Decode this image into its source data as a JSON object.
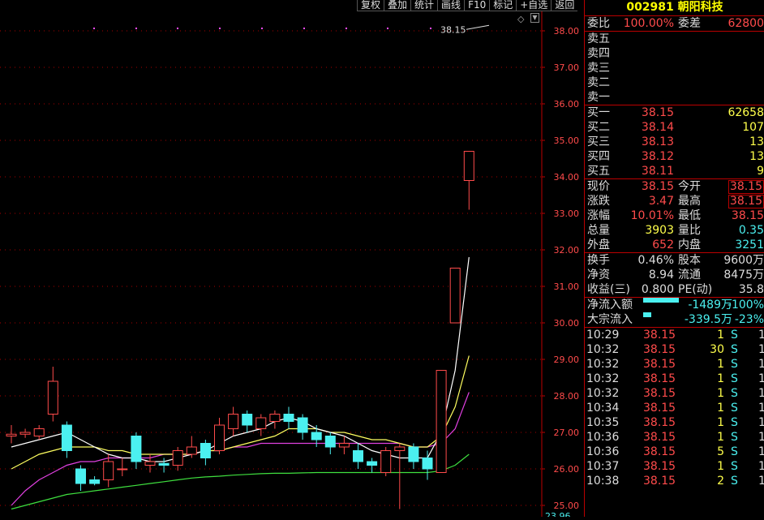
{
  "toolbar": [
    "复权",
    "叠加",
    "统计",
    "画线",
    "F10",
    "标记",
    "+自选",
    "返回"
  ],
  "chart_data": {
    "type": "candlestick",
    "y_ticks": [
      "38.00",
      "37.00",
      "36.00",
      "35.00",
      "34.00",
      "33.00",
      "32.00",
      "31.00",
      "30.00",
      "29.00",
      "28.00",
      "27.00",
      "26.00",
      "25.00"
    ],
    "ylim": [
      24.8,
      38.4
    ],
    "bottom_label": "23.96",
    "price_flag": "38.15",
    "candles": [
      {
        "o": 26.9,
        "c": 26.95,
        "h": 27.2,
        "l": 26.7
      },
      {
        "o": 26.95,
        "c": 27.0,
        "h": 27.1,
        "l": 26.85
      },
      {
        "o": 26.9,
        "c": 27.1,
        "h": 27.2,
        "l": 26.8
      },
      {
        "o": 27.5,
        "c": 28.4,
        "h": 28.8,
        "l": 27.3
      },
      {
        "o": 27.2,
        "c": 26.5,
        "h": 27.3,
        "l": 26.3
      },
      {
        "o": 26.0,
        "c": 25.6,
        "h": 26.1,
        "l": 25.4
      },
      {
        "o": 25.7,
        "c": 25.6,
        "h": 25.8,
        "l": 25.55
      },
      {
        "o": 25.7,
        "c": 26.2,
        "h": 26.4,
        "l": 25.5
      },
      {
        "o": 26.0,
        "c": 26.0,
        "h": 26.3,
        "l": 25.8
      },
      {
        "o": 26.9,
        "c": 26.2,
        "h": 27.0,
        "l": 26.0
      },
      {
        "o": 26.1,
        "c": 26.2,
        "h": 26.4,
        "l": 25.9
      },
      {
        "o": 26.15,
        "c": 26.1,
        "h": 26.3,
        "l": 25.9
      },
      {
        "o": 26.1,
        "c": 26.5,
        "h": 26.6,
        "l": 25.95
      },
      {
        "o": 26.4,
        "c": 26.6,
        "h": 26.9,
        "l": 26.3
      },
      {
        "o": 26.7,
        "c": 26.3,
        "h": 26.8,
        "l": 26.1
      },
      {
        "o": 26.5,
        "c": 27.2,
        "h": 27.4,
        "l": 26.4
      },
      {
        "o": 27.1,
        "c": 27.5,
        "h": 27.7,
        "l": 26.9
      },
      {
        "o": 27.5,
        "c": 27.2,
        "h": 27.6,
        "l": 27.0
      },
      {
        "o": 27.1,
        "c": 27.4,
        "h": 27.5,
        "l": 26.9
      },
      {
        "o": 27.3,
        "c": 27.5,
        "h": 27.6,
        "l": 27.1
      },
      {
        "o": 27.5,
        "c": 27.3,
        "h": 27.7,
        "l": 27.1
      },
      {
        "o": 27.4,
        "c": 27.0,
        "h": 27.5,
        "l": 26.8
      },
      {
        "o": 27.0,
        "c": 26.8,
        "h": 27.2,
        "l": 26.6
      },
      {
        "o": 26.9,
        "c": 26.6,
        "h": 27.0,
        "l": 26.4
      },
      {
        "o": 26.6,
        "c": 26.7,
        "h": 26.9,
        "l": 26.4
      },
      {
        "o": 26.5,
        "c": 26.2,
        "h": 26.7,
        "l": 26.0
      },
      {
        "o": 26.2,
        "c": 26.1,
        "h": 26.3,
        "l": 25.9
      },
      {
        "o": 25.9,
        "c": 26.5,
        "h": 26.6,
        "l": 25.8
      },
      {
        "o": 26.5,
        "c": 26.6,
        "h": 26.7,
        "l": 24.9
      },
      {
        "o": 26.6,
        "c": 26.2,
        "h": 26.7,
        "l": 26.0
      },
      {
        "o": 26.3,
        "c": 26.0,
        "h": 26.5,
        "l": 25.7
      },
      {
        "o": 25.9,
        "c": 28.7,
        "h": 28.7,
        "l": 25.9
      },
      {
        "o": 30.0,
        "c": 31.5,
        "h": 31.5,
        "l": 30.0
      },
      {
        "o": 33.9,
        "c": 34.7,
        "h": 34.7,
        "l": 33.1
      }
    ],
    "ma_white": [
      26.6,
      26.7,
      26.8,
      26.9,
      27.0,
      26.8,
      26.6,
      26.4,
      26.3,
      26.3,
      26.2,
      26.2,
      26.3,
      26.4,
      26.5,
      26.7,
      26.9,
      27.0,
      27.1,
      27.3,
      27.4,
      27.3,
      27.1,
      27.0,
      26.9,
      26.7,
      26.5,
      26.4,
      26.3,
      26.3,
      26.3,
      27.0,
      28.7,
      31.8
    ],
    "ma_yellow": [
      26.0,
      26.2,
      26.4,
      26.5,
      26.6,
      26.6,
      26.6,
      26.5,
      26.5,
      26.4,
      26.4,
      26.4,
      26.4,
      26.4,
      26.5,
      26.5,
      26.6,
      26.7,
      26.8,
      26.9,
      27.1,
      27.1,
      27.1,
      27.0,
      27.0,
      26.9,
      26.8,
      26.8,
      26.7,
      26.6,
      26.6,
      26.9,
      27.7,
      29.1
    ],
    "ma_magenta": [
      25.0,
      25.4,
      25.7,
      25.9,
      26.1,
      26.2,
      26.2,
      26.3,
      26.3,
      26.3,
      26.3,
      26.4,
      26.4,
      26.4,
      26.5,
      26.5,
      26.6,
      26.6,
      26.7,
      26.7,
      26.7,
      26.7,
      26.7,
      26.7,
      26.7,
      26.7,
      26.7,
      26.7,
      26.7,
      26.6,
      26.6,
      26.7,
      27.1,
      28.1
    ],
    "ma_green": [
      24.9,
      25.0,
      25.1,
      25.2,
      25.3,
      25.35,
      25.4,
      25.45,
      25.5,
      25.55,
      25.6,
      25.65,
      25.7,
      25.75,
      25.78,
      25.8,
      25.83,
      25.85,
      25.87,
      25.88,
      25.88,
      25.89,
      25.9,
      25.9,
      25.9,
      25.9,
      25.9,
      25.9,
      25.9,
      25.9,
      25.9,
      25.95,
      26.1,
      26.4
    ]
  },
  "panel": {
    "title": "002981 朝阳科技",
    "wb": {
      "label1": "委比",
      "value1": "100.00%",
      "label2": "委差",
      "value2": "62800"
    },
    "asks": [
      {
        "label": "卖五"
      },
      {
        "label": "卖四"
      },
      {
        "label": "卖三"
      },
      {
        "label": "卖二"
      },
      {
        "label": "卖一"
      }
    ],
    "bids": [
      {
        "label": "买一",
        "price": "38.15",
        "vol": "62658"
      },
      {
        "label": "买二",
        "price": "38.14",
        "vol": "107"
      },
      {
        "label": "买三",
        "price": "38.13",
        "vol": "13"
      },
      {
        "label": "买四",
        "price": "38.12",
        "vol": "13"
      },
      {
        "label": "买五",
        "price": "38.11",
        "vol": "9"
      }
    ],
    "quote": [
      {
        "l1": "现价",
        "v1": "38.15",
        "l2": "今开",
        "v2": "38.15"
      },
      {
        "l1": "涨跌",
        "v1": "3.47",
        "l2": "最高",
        "v2": "38.15"
      },
      {
        "l1": "涨幅",
        "v1": "10.01%",
        "l2": "最低",
        "v2": "38.15"
      },
      {
        "l1": "总量",
        "v1": "3903",
        "l2": "量比",
        "v2": "0.35"
      },
      {
        "l1": "外盘",
        "v1": "652",
        "l2": "内盘",
        "v2": "3251"
      }
    ],
    "fund": [
      {
        "l1": "换手",
        "v1": "0.46%",
        "l2": "股本",
        "v2": "9600万"
      },
      {
        "l1": "净资",
        "v1": "8.94",
        "l2": "流通",
        "v2": "8475万"
      },
      {
        "l1": "收益(三)",
        "v1": "0.800",
        "l2": "PE(动)",
        "v2": "35.8"
      }
    ],
    "flow": [
      {
        "label": "净流入额",
        "value": "-1489万",
        "pct": "-100%",
        "bar_fraction": 1.0
      },
      {
        "label": "大宗流入",
        "value": "-339.5万",
        "pct": "-23%",
        "bar_fraction": 0.23
      }
    ],
    "trades": [
      {
        "time": "10:29",
        "price": "38.15",
        "vol": "1",
        "bs": "S",
        "cnt": "1"
      },
      {
        "time": "10:32",
        "price": "38.15",
        "vol": "30",
        "bs": "S",
        "cnt": "1"
      },
      {
        "time": "10:32",
        "price": "38.15",
        "vol": "1",
        "bs": "S",
        "cnt": "1"
      },
      {
        "time": "10:32",
        "price": "38.15",
        "vol": "1",
        "bs": "S",
        "cnt": "1"
      },
      {
        "time": "10:32",
        "price": "38.15",
        "vol": "1",
        "bs": "S",
        "cnt": "1"
      },
      {
        "time": "10:34",
        "price": "38.15",
        "vol": "1",
        "bs": "S",
        "cnt": "1"
      },
      {
        "time": "10:35",
        "price": "38.15",
        "vol": "1",
        "bs": "S",
        "cnt": "1"
      },
      {
        "time": "10:36",
        "price": "38.15",
        "vol": "1",
        "bs": "S",
        "cnt": "1"
      },
      {
        "time": "10:36",
        "price": "38.15",
        "vol": "5",
        "bs": "S",
        "cnt": "1"
      },
      {
        "time": "10:37",
        "price": "38.15",
        "vol": "1",
        "bs": "S",
        "cnt": "1"
      },
      {
        "time": "10:38",
        "price": "38.15",
        "vol": "2",
        "bs": "S",
        "cnt": "1"
      }
    ]
  }
}
